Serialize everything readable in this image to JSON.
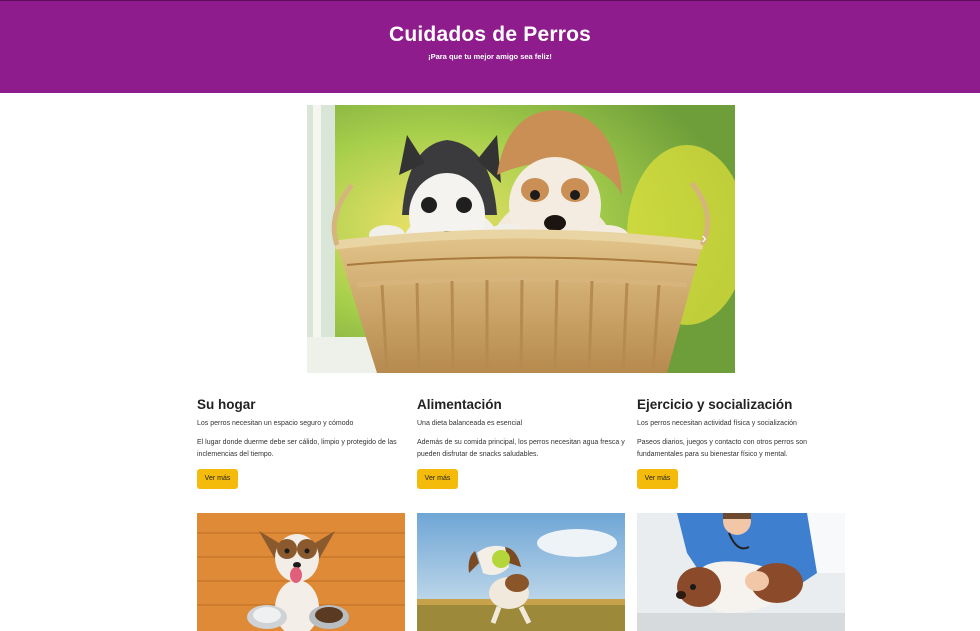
{
  "header": {
    "title": "Cuidados de Perros",
    "subtitle": "¡Para que tu mejor amigo sea feliz!"
  },
  "carousel": {
    "next_icon": "chevron-right-icon",
    "next_glyph": "›"
  },
  "sections": [
    {
      "title": "Su hogar",
      "lead": "Los perros necesitan un espacio seguro y cómodo",
      "body": "El lugar donde duerme debe ser cálido, limpio y protegido de las inclemencias del tiempo.",
      "button": "Ver más"
    },
    {
      "title": "Alimentación",
      "lead": "Una dieta balanceada es esencial",
      "body": "Además de su comida principal, los perros necesitan agua fresca y pueden disfrutar de snacks saludables.",
      "button": "Ver más"
    },
    {
      "title": "Ejercicio y socialización",
      "lead": "Los perros necesitan actividad física y socialización",
      "body": "Paseos diarios, juegos y contacto con otros perros son fundamentales para su bienestar físico y mental.",
      "button": "Ver más"
    }
  ],
  "colors": {
    "header_bg": "#8f1c8d",
    "button_bg": "#f4bb0a"
  }
}
